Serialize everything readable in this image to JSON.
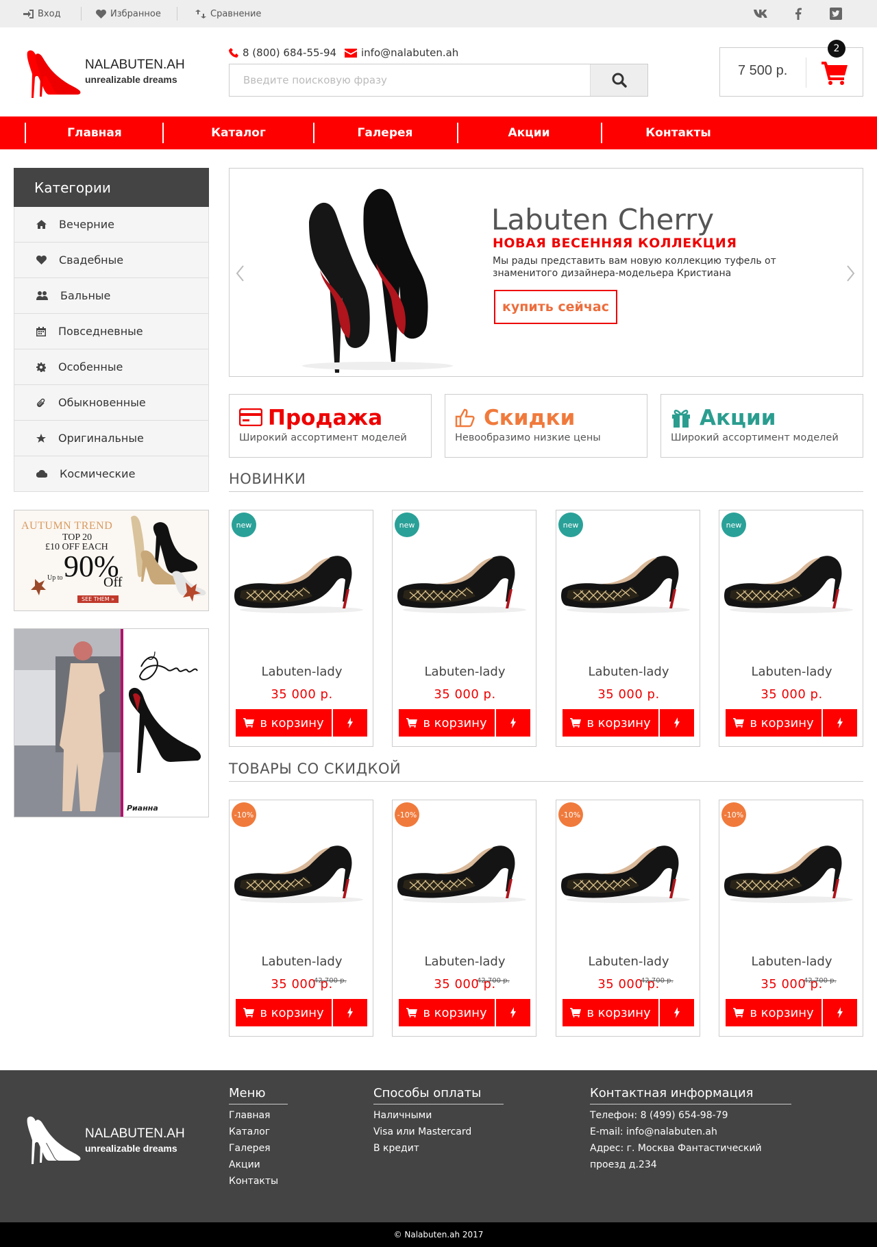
{
  "topbar": {
    "login": "Вход",
    "favorites": "Избранное",
    "compare": "Сравнение",
    "social": [
      "vk-icon",
      "facebook-icon",
      "twitter-icon"
    ]
  },
  "header": {
    "logo_name": "NALABUTEN.AH",
    "logo_slogan": "unrealizable dreams",
    "phone": "8 (800) 684-55-94",
    "email": "info@nalabuten.ah",
    "search_placeholder": "Введите поисковую фразу",
    "cart_total": "7 500 р.",
    "cart_count": "2"
  },
  "nav": [
    "Главная",
    "Каталог",
    "Галерея",
    "Акции",
    "Контакты"
  ],
  "sidebar": {
    "title": "Категории",
    "items": [
      {
        "label": "Вечерние",
        "icon": "home-icon"
      },
      {
        "label": "Свадебные",
        "icon": "heart-icon"
      },
      {
        "label": "Бальные",
        "icon": "users-icon"
      },
      {
        "label": "Повседневные",
        "icon": "calendar-icon"
      },
      {
        "label": "Особенные",
        "icon": "gear-icon"
      },
      {
        "label": "Обыкновенные",
        "icon": "paperclip-icon"
      },
      {
        "label": "Оригинальные",
        "icon": "star-icon"
      },
      {
        "label": "Космические",
        "icon": "cloud-icon"
      }
    ],
    "promo1": {
      "trend": "AUTUMN TREND",
      "top": "TOP 20",
      "off": "£10 OFF EACH",
      "upto": "Up to",
      "pct": "90%",
      "offword": "Off",
      "btn": "SEE THEM »"
    },
    "promo2": {
      "brand": "Christian Louboutin",
      "caption": "Рианна"
    }
  },
  "slider": {
    "title": "Labuten Cherry",
    "subtitle": "НОВАЯ ВЕСЕННЯЯ КОЛЛЕКЦИЯ",
    "description": "Мы рады представить вам новую коллекцию туфель от знаменитого дизайнера-модельера Кристиана",
    "button": "купить сейчас"
  },
  "features": [
    {
      "title": "Продажа",
      "desc": "Широкий ассортимент моделей",
      "color": "#e00000",
      "icon": "credit-card-icon"
    },
    {
      "title": "Скидки",
      "desc": "Невообразимо низкие цены",
      "color": "#f07a3c",
      "icon": "thumbs-up-icon"
    },
    {
      "title": "Акции",
      "desc": "Широкий ассортимент моделей",
      "color": "#2a9d8f",
      "icon": "gift-icon"
    }
  ],
  "new_section": {
    "title": "НОВИНКИ",
    "products": [
      {
        "tag": "new",
        "name": "Labuten-lady",
        "price": "35 000 р.",
        "cart": "в корзину"
      },
      {
        "tag": "new",
        "name": "Labuten-lady",
        "price": "35 000 р.",
        "cart": "в корзину"
      },
      {
        "tag": "new",
        "name": "Labuten-lady",
        "price": "35 000 р.",
        "cart": "в корзину"
      },
      {
        "tag": "new",
        "name": "Labuten-lady",
        "price": "35 000 р.",
        "cart": "в корзину"
      }
    ]
  },
  "sale_section": {
    "title": "ТОВАРЫ СО СКИДКОЙ",
    "products": [
      {
        "tag": "-10%",
        "name": "Labuten-lady",
        "old_price": "42 700 р.",
        "price": "35 000 р.",
        "cart": "в корзину"
      },
      {
        "tag": "-10%",
        "name": "Labuten-lady",
        "old_price": "42 700 р.",
        "price": "35 000 р.",
        "cart": "в корзину"
      },
      {
        "tag": "-10%",
        "name": "Labuten-lady",
        "old_price": "42 700 р.",
        "price": "35 000 р.",
        "cart": "в корзину"
      },
      {
        "tag": "-10%",
        "name": "Labuten-lady",
        "old_price": "42 700 р.",
        "price": "35 000 р.",
        "cart": "в корзину"
      }
    ]
  },
  "footer": {
    "logo_name": "NALABUTEN.AH",
    "logo_slogan": "unrealizable dreams",
    "menu_title": "Меню",
    "menu": [
      "Главная",
      "Каталог",
      "Галерея",
      "Акции",
      "Контакты"
    ],
    "pay_title": "Способы оплаты",
    "pay": [
      "Наличными",
      "Visa или Mastercard",
      "В кредит"
    ],
    "contact_title": "Контактная информация",
    "contact": [
      "Телефон: 8 (499) 654-98-79",
      "E-mail: info@nalabuten.ah",
      "Адрес: г. Москва Фантастический",
      "проезд д.234"
    ],
    "copyright": "© Nalabuten.ah 2017"
  },
  "colors": {
    "brand": "#ff0000",
    "new_tag": "#2aa198",
    "sale_tag": "#f07a3c",
    "footer": "#444444"
  }
}
